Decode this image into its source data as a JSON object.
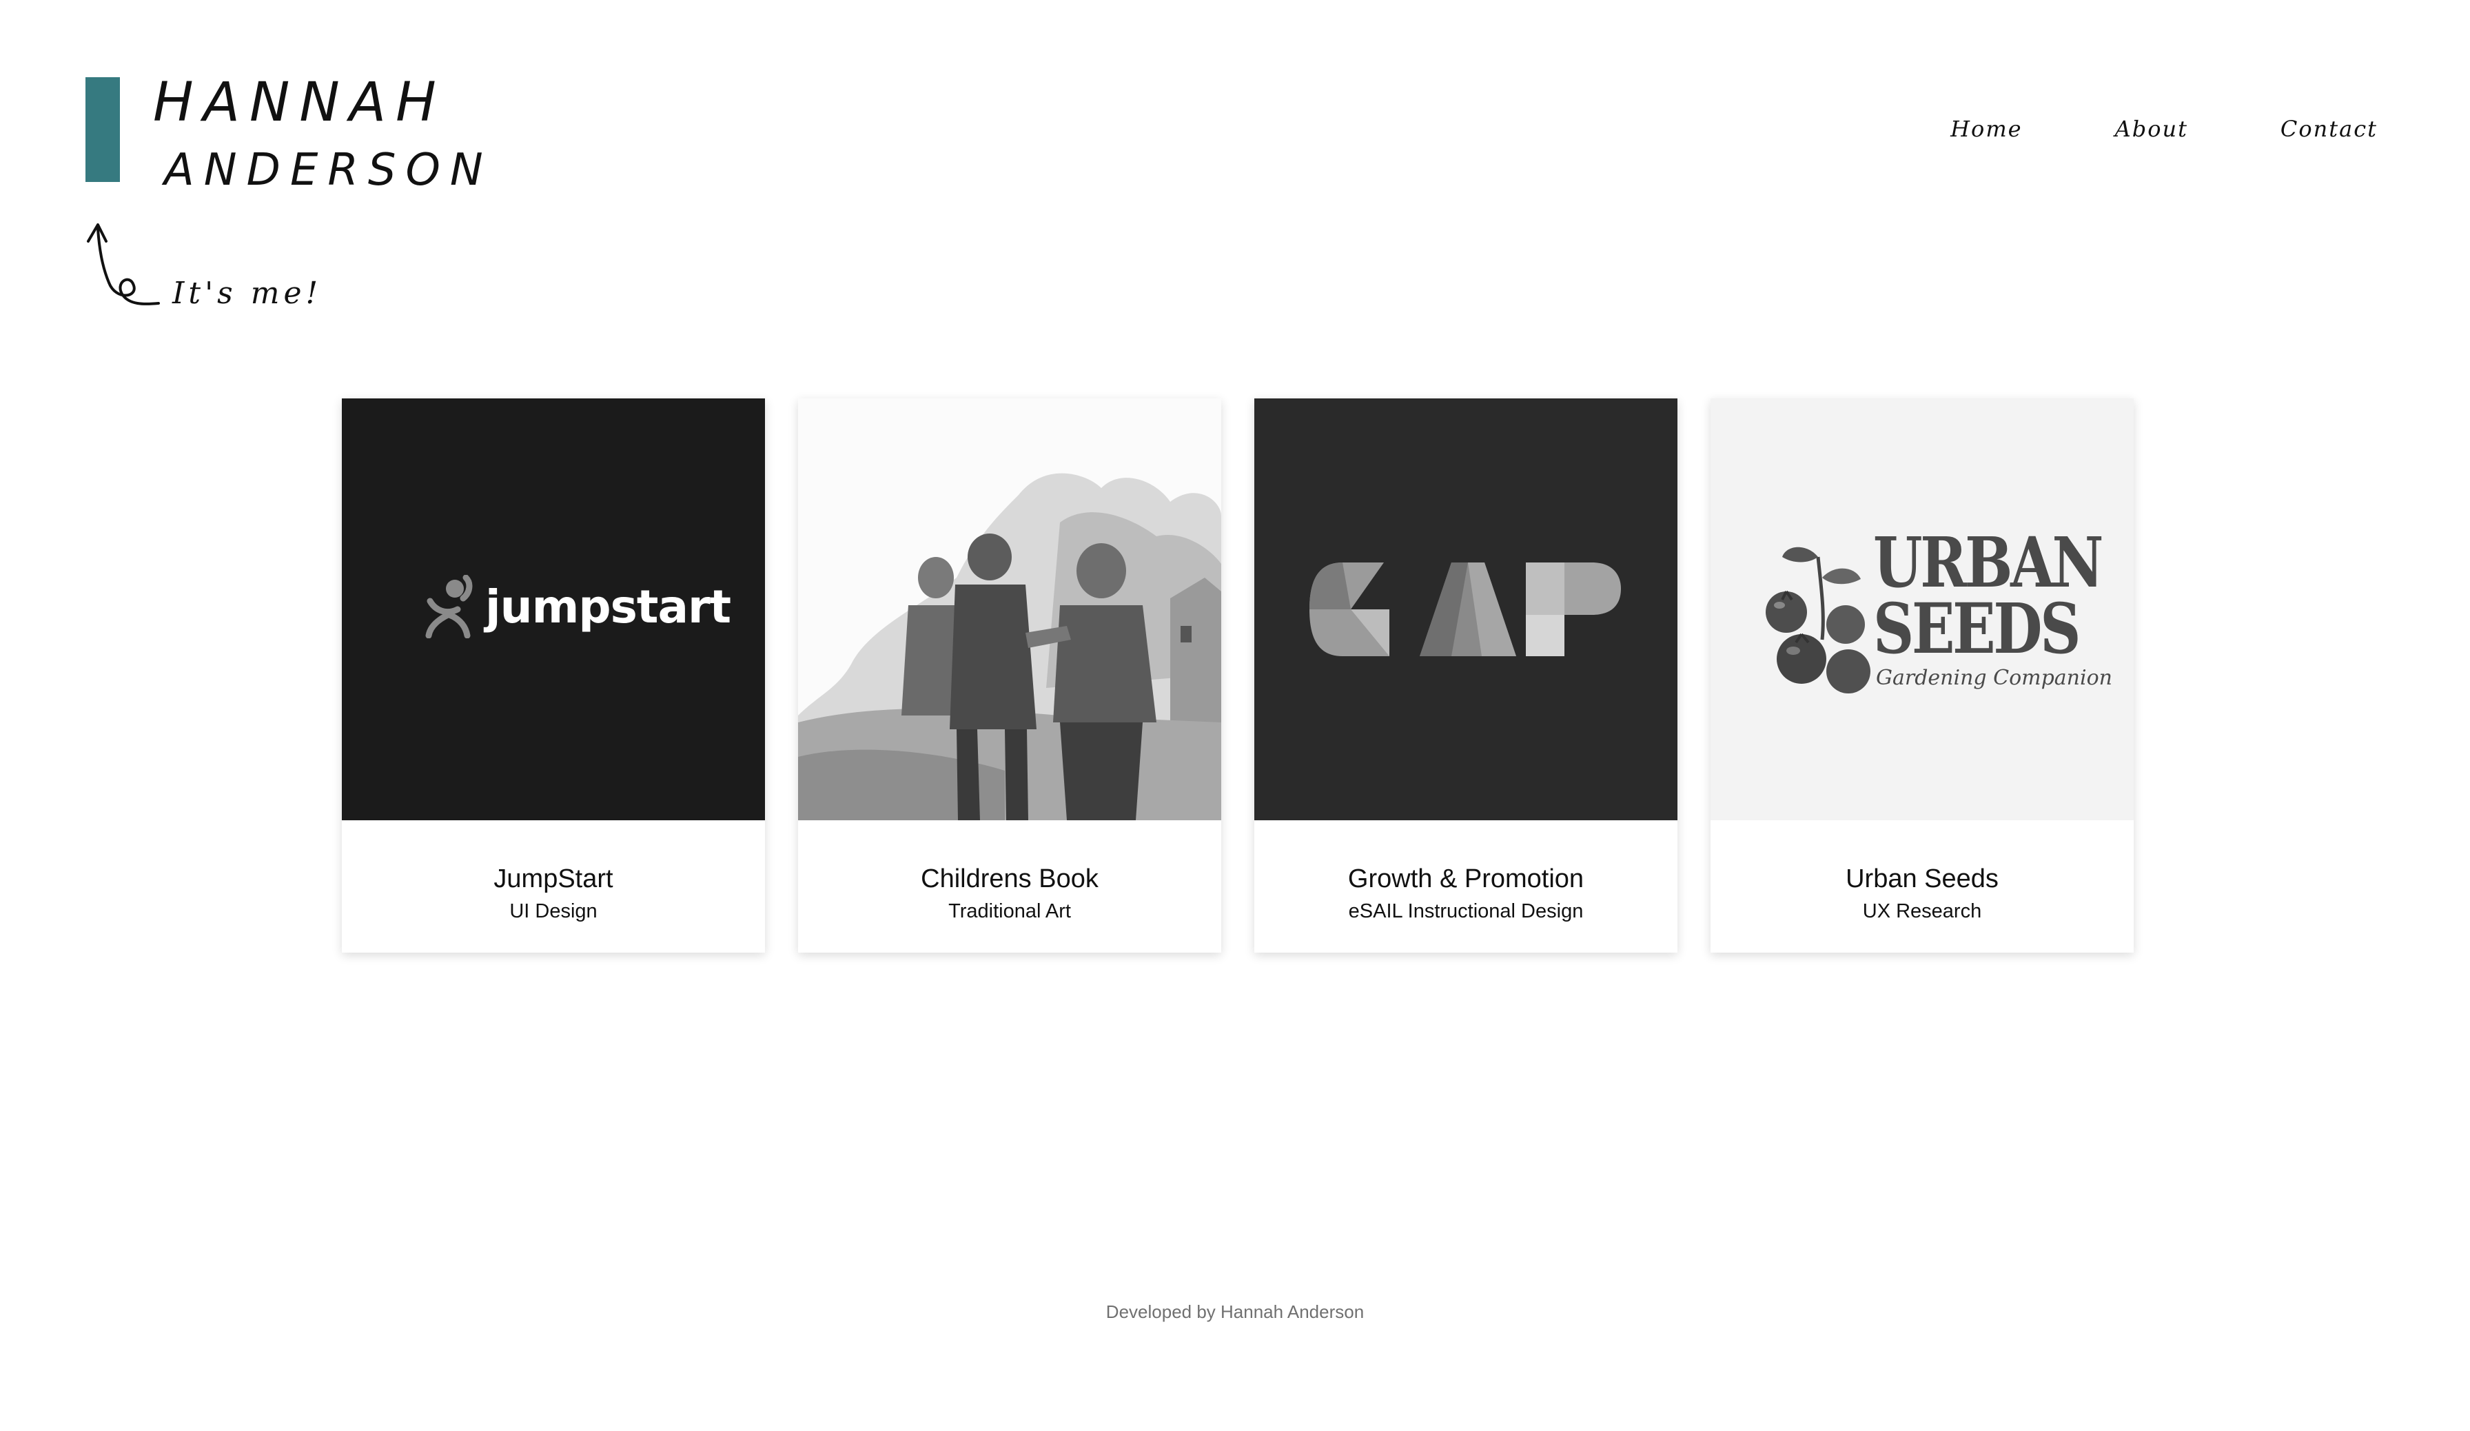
{
  "header": {
    "first_name": "HANNAH",
    "last_name": "ANDERSON",
    "tagline": "It's me!",
    "accent_color": "#367a80"
  },
  "nav": {
    "items": [
      {
        "label": "Home"
      },
      {
        "label": "About"
      },
      {
        "label": "Contact"
      }
    ]
  },
  "projects": [
    {
      "title": "JumpStart",
      "subtitle": "UI Design",
      "logo_text": "jumpstart",
      "image_bg": "#1b1b1b"
    },
    {
      "title": "Childrens Book",
      "subtitle": "Traditional Art",
      "image_bg": "#fbfbfb"
    },
    {
      "title": "Growth & Promotion",
      "subtitle": "eSAIL Instructional Design",
      "logo_text": "GAP",
      "image_bg": "#2a2a2a"
    },
    {
      "title": "Urban Seeds",
      "subtitle": "UX Research",
      "logo_text": [
        "URBAN",
        "SEEDS"
      ],
      "logo_tagline": "Gardening Companion",
      "image_bg": "#f3f3f3"
    }
  ],
  "footer": {
    "text": "Developed by Hannah Anderson"
  }
}
